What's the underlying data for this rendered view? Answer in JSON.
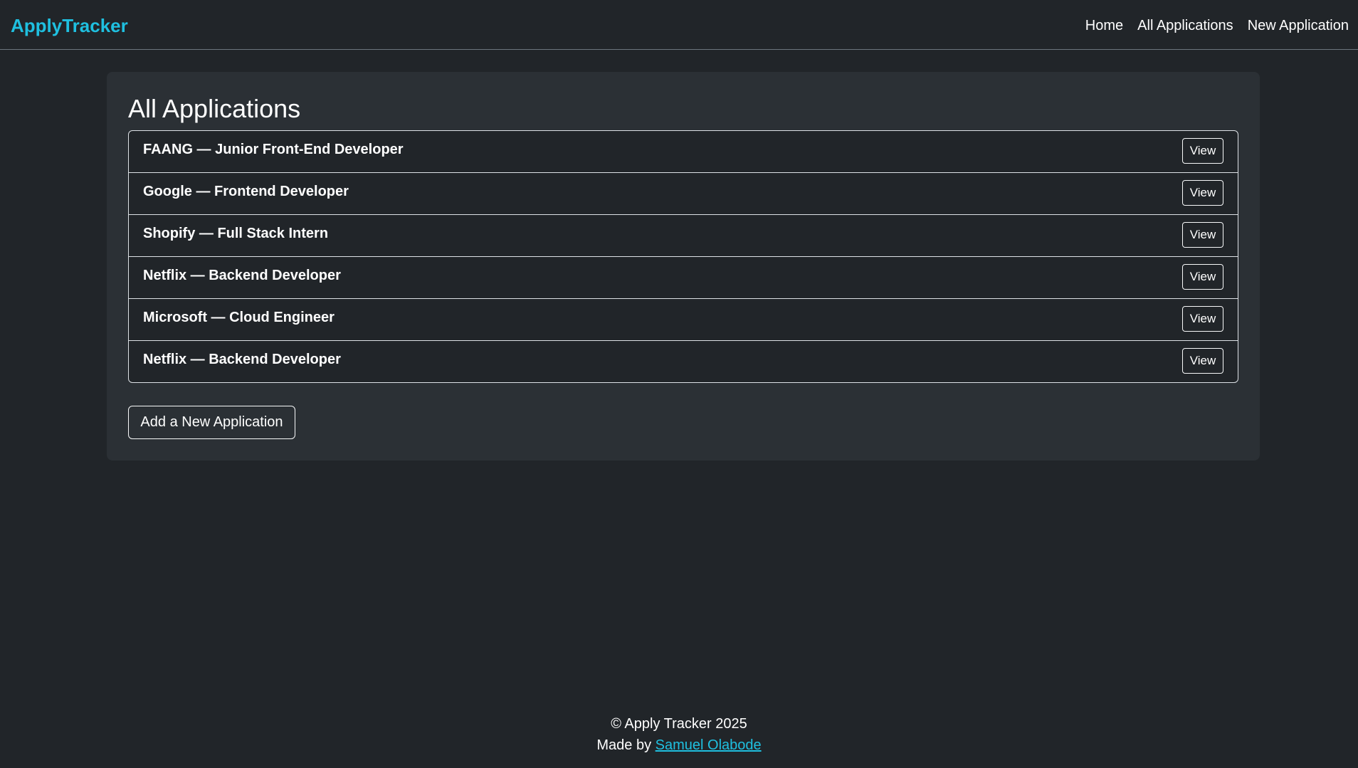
{
  "navbar": {
    "brand": "ApplyTracker",
    "links": [
      {
        "label": "Home"
      },
      {
        "label": "All Applications"
      },
      {
        "label": "New Application"
      }
    ]
  },
  "main": {
    "title": "All Applications",
    "applications": [
      {
        "label": "FAANG — Junior Front-End Developer",
        "button": "View"
      },
      {
        "label": "Google — Frontend Developer",
        "button": "View"
      },
      {
        "label": "Shopify — Full Stack Intern",
        "button": "View"
      },
      {
        "label": "Netflix — Backend Developer",
        "button": "View"
      },
      {
        "label": "Microsoft — Cloud Engineer",
        "button": "View"
      },
      {
        "label": "Netflix — Backend Developer",
        "button": "View"
      }
    ],
    "add_button": "Add a New Application"
  },
  "footer": {
    "copyright": "© Apply Tracker 2025",
    "made_by_prefix": "Made by",
    "author": "Samuel Olabode"
  },
  "colors": {
    "background": "#212529",
    "card": "#2b3035",
    "accent": "#1fc0e0",
    "border": "#dee2e6"
  }
}
